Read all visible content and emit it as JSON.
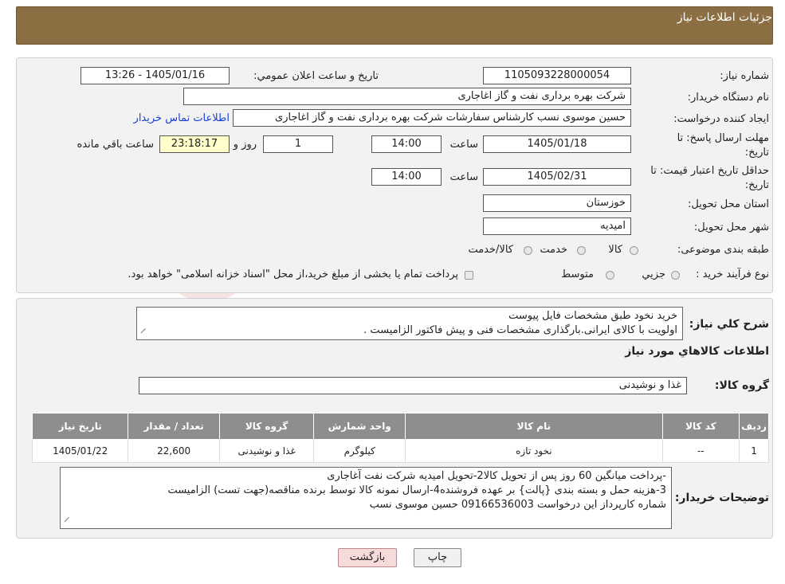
{
  "header": {
    "title": "جزئیات اطلاعات نیاز"
  },
  "form": {
    "need_number_label": "شماره نیاز:",
    "need_number": "1105093228000054",
    "announce_label": "تاریخ و ساعت اعلان عمومي:",
    "announce_value": "1405/01/16 - 13:26",
    "buyer_org_label": "نام دستگاه خريدار:",
    "buyer_org": "شرکت بهره برداری نفت و گاز اغاجاری",
    "requester_label": "ايجاد کننده درخواست:",
    "requester": "حسین موسوی نسب کارشناس سفارشات شرکت بهره برداری نفت و گاز اغاجاری",
    "contact_link": "اطلاعات تماس خريدار",
    "deadline_label_1": "مهلت ارسال پاسخ: تا",
    "deadline_label_2": "تاريخ:",
    "deadline_date": "1405/01/18",
    "time_label": "ساعت",
    "deadline_time": "14:00",
    "days_value": "1",
    "days_label": "روز و",
    "remaining_time": "23:18:17",
    "remaining_label": "ساعت باقي مانده",
    "validity_label_1": "حداقل تاريخ اعتبار قيمت: تا",
    "validity_label_2": "تاريخ:",
    "validity_date": "1405/02/31",
    "validity_time": "14:00",
    "province_label": "استان محل تحويل:",
    "province": "خوزستان",
    "city_label": "شهر محل تحويل:",
    "city": "امیدیه",
    "category_label": "طبقه بندی موضوعی:",
    "category_options": [
      "کالا",
      "خدمت",
      "کالا/خدمت"
    ],
    "purchase_label": "نوع فرآيند خريد :",
    "purchase_options": [
      "جزيي",
      "متوسط"
    ],
    "purchase_note": "پرداخت تمام یا بخشی از مبلغ خرید،از محل \"اسناد خزانه اسلامی\" خواهد بود."
  },
  "summary": {
    "label": "شرح كلي نياز:",
    "line1": "خرید نخود طبق  مشخصات فایل پیوست",
    "line2": "اولویت با کالای ایرانی.بارگذاری مشخصات فنی و پیش فاکتور الزامیست ."
  },
  "goods": {
    "section_title": "اطلاعات کالاهاي مورد نياز",
    "group_label": "گروه کالا:",
    "group_value": "غذا و نوشیدنی",
    "columns": [
      "رديف",
      "کد کالا",
      "نام کالا",
      "واحد شمارش",
      "گروه کالا",
      "تعداد / مقدار",
      "تاريخ نياز"
    ],
    "rows": [
      [
        "1",
        "--",
        "نخود تازه",
        "کیلوگرم",
        "غذا و نوشیدنی",
        "22,600",
        "1405/01/22"
      ]
    ]
  },
  "notes": {
    "label": "توضيحات خريدار:",
    "line1": "-پرداخت میانگین 60 روز پس از تحویل کالا2-تحویل امیدیه شرکت نفت آغاجاری",
    "line2": "3-هزینه حمل  و بسته بندی {پالت} بر عهده فروشنده4-ارسال نمونه کالا توسط برنده مناقصه(جهت تست) الزامیست",
    "line3": "شماره کارپرداز این درخواست 09166536003 حسین موسوی نسب"
  },
  "buttons": {
    "print": "چاپ",
    "back": "بازگشت"
  },
  "colors": {
    "header_bg": "#8b6f43",
    "table_header_bg": "#8e8e8e",
    "back_button_bg": "#f7dada",
    "link": "#1a3fd1"
  }
}
